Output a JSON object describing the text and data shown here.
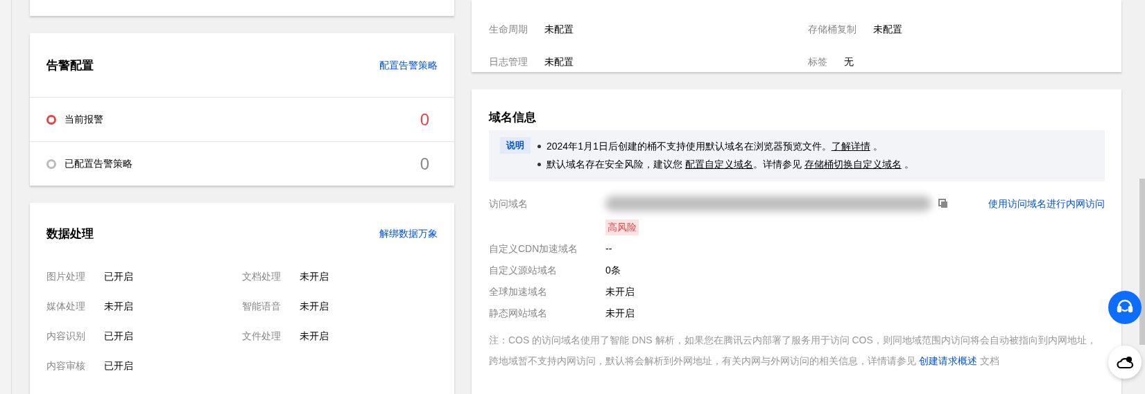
{
  "storage_config": {
    "items": [
      {
        "label": "生命周期",
        "value": "未配置"
      },
      {
        "label": "存储桶复制",
        "value": "未配置"
      },
      {
        "label": "日志管理",
        "value": "未配置"
      },
      {
        "label": "标签",
        "value": "无"
      }
    ]
  },
  "alert_config": {
    "title": "告警配置",
    "link": "配置告警策略",
    "items": [
      {
        "label": "当前报警",
        "count": "0",
        "color": "#e54545",
        "kind": "active"
      },
      {
        "label": "已配置告警策略",
        "count": "0",
        "color": "#bbbbbb",
        "kind": "configured"
      }
    ]
  },
  "data_processing": {
    "title": "数据处理",
    "link": "解绑数据万象",
    "items": [
      {
        "label": "图片处理",
        "value": "已开启"
      },
      {
        "label": "文档处理",
        "value": "未开启"
      },
      {
        "label": "媒体处理",
        "value": "未开启"
      },
      {
        "label": "智能语音",
        "value": "未开启"
      },
      {
        "label": "内容识别",
        "value": "已开启"
      },
      {
        "label": "文件处理",
        "value": "未开启"
      },
      {
        "label": "内容审核",
        "value": "已开启"
      }
    ]
  },
  "domain_info": {
    "title": "域名信息",
    "notice": {
      "tag": "说明",
      "lines": [
        [
          {
            "kind": "text",
            "text": "2024年1月1日后创建的桶不支持使用默认域名在浏览器预览文件。"
          },
          {
            "kind": "link",
            "text": "了解详情"
          },
          {
            "kind": "text",
            "text": " 。"
          }
        ],
        [
          {
            "kind": "text",
            "text": "默认域名存在安全风险，建议您 "
          },
          {
            "kind": "link",
            "text": "配置自定义域名"
          },
          {
            "kind": "text",
            "text": "。详情参见 "
          },
          {
            "kind": "link",
            "text": "存储桶切换自定义域名"
          },
          {
            "kind": "text",
            "text": " 。"
          }
        ]
      ]
    },
    "rows": [
      {
        "kind": "access",
        "label": "访问域名",
        "risk_tag": "高风险",
        "action": "使用访问域名进行内网访问"
      },
      {
        "kind": "plain",
        "label": "自定义CDN加速域名",
        "value": "--"
      },
      {
        "kind": "plain",
        "label": "自定义源站域名",
        "value": "0条"
      },
      {
        "kind": "plain",
        "label": "全球加速域名",
        "value": "未开启"
      },
      {
        "kind": "plain",
        "label": "静态网站域名",
        "value": "未开启"
      }
    ],
    "note": [
      {
        "kind": "text",
        "text": "注：COS 的访问域名使用了智能 DNS 解析，如果您在腾讯云内部署了服务用于访问 COS，则同地域范围内访问将会自动被指向到内网地址，跨地域暂不支持内网访问，默认将会解析到外网地址，有关内网与外网访问的相关信息，详情请参见 "
      },
      {
        "kind": "link",
        "text": "创建请求概述"
      },
      {
        "kind": "text",
        "text": " 文档"
      }
    ]
  }
}
